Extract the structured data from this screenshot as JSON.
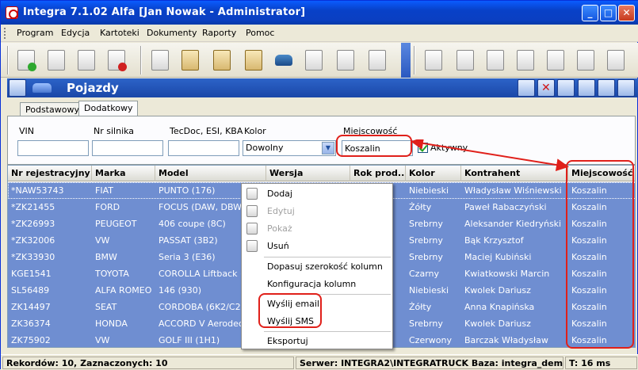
{
  "window": {
    "title": "Integra 7.1.02 Alfa [Jan Nowak - Administrator]",
    "minimize": "_",
    "maximize": "□",
    "close": "✕"
  },
  "menu": [
    "Program",
    "Edycja",
    "Kartoteki",
    "Dokumenty",
    "Raporty",
    "Pomoc"
  ],
  "module": {
    "title": "Pojazdy"
  },
  "tabs": [
    "Podstawowy",
    "Dodatkowy"
  ],
  "filters": {
    "vin_label": "VIN",
    "vin_value": "",
    "engine_label": "Nr silnika",
    "engine_value": "",
    "tecdoc_label": "TecDoc, ESI, KBA",
    "tecdoc_value": "",
    "color_label": "Kolor",
    "color_value": "Dowolny",
    "city_label": "Miejscowość",
    "city_value": "Koszalin",
    "active_label": "Aktywny",
    "active_checked": true
  },
  "table": {
    "columns": [
      "Nr rejestracyjny",
      "Marka",
      "Model",
      "Wersja",
      "Rok prod...",
      "Kolor",
      "Kontrahent",
      "Miejscowość"
    ],
    "rows": [
      {
        "reg": "*NAW53743",
        "make": "FIAT",
        "model": "PUNTO (176)",
        "color": "Niebieski",
        "client": "Władysław Wiśniewski",
        "city": "Koszalin"
      },
      {
        "reg": "*ZK21455",
        "make": "FORD",
        "model": "FOCUS (DAW, DBW)",
        "color": "Żółty",
        "client": "Paweł Rabaczyński",
        "city": "Koszalin"
      },
      {
        "reg": "*ZK26993",
        "make": "PEUGEOT",
        "model": "406 coupe (8C)",
        "color": "Srebrny",
        "client": "Aleksander Kiedryński",
        "city": "Koszalin"
      },
      {
        "reg": "*ZK32006",
        "make": "VW",
        "model": "PASSAT (3B2)",
        "color": "Srebrny",
        "client": "Bąk Krzysztof",
        "city": "Koszalin"
      },
      {
        "reg": "*ZK33930",
        "make": "BMW",
        "model": "Seria 3 (E36)",
        "color": "Srebrny",
        "client": "Maciej Kubiński",
        "city": "Koszalin"
      },
      {
        "reg": "KGE1541",
        "make": "TOYOTA",
        "model": "COROLLA Liftback (_I",
        "color": "Czarny",
        "client": "Kwiatkowski Marcin",
        "city": "Koszalin"
      },
      {
        "reg": "SL56489",
        "make": "ALFA ROMEO",
        "model": "146 (930)",
        "color": "Niebieski",
        "client": "Kwolek Dariusz",
        "city": "Koszalin"
      },
      {
        "reg": "ZK14497",
        "make": "SEAT",
        "model": "CORDOBA (6K2/C2)",
        "color": "Żółty",
        "client": "Anna Knapińska",
        "city": "Koszalin"
      },
      {
        "reg": "ZK36374",
        "make": "HONDA",
        "model": "ACCORD V Aerodeck",
        "color": "Srebrny",
        "client": "Kwolek Dariusz",
        "city": "Koszalin"
      },
      {
        "reg": "ZK75902",
        "make": "VW",
        "model": "GOLF III (1H1)",
        "color": "Czerwony",
        "client": "Barczak Władysław",
        "city": "Koszalin"
      }
    ]
  },
  "context_menu": {
    "items": [
      {
        "label": "Dodaj",
        "icon": "add-doc-icon",
        "disabled": false
      },
      {
        "label": "Edytuj",
        "icon": "edit-doc-icon",
        "disabled": true
      },
      {
        "label": "Pokaż",
        "icon": "view-doc-icon",
        "disabled": true
      },
      {
        "label": "Usuń",
        "icon": "delete-doc-icon",
        "disabled": false
      },
      {
        "label": "Dopasuj szerokość kolumn",
        "disabled": false
      },
      {
        "label": "Konfiguracja kolumn",
        "disabled": false
      },
      {
        "label": "Wyślij email",
        "disabled": false
      },
      {
        "label": "Wyślij SMS",
        "disabled": false
      },
      {
        "label": "Eksportuj",
        "disabled": false
      }
    ]
  },
  "status": {
    "records": "Rekordów: 10, Zaznaczonych: 10",
    "server": "Serwer: INTEGRA2\\INTEGRATRUCK",
    "db": "Baza: integra_demo",
    "time": "T: 16 ms"
  },
  "colors": {
    "title_blue": "#0a49d6",
    "selection": "#6f8ed1",
    "annotation_red": "#e0201a"
  }
}
